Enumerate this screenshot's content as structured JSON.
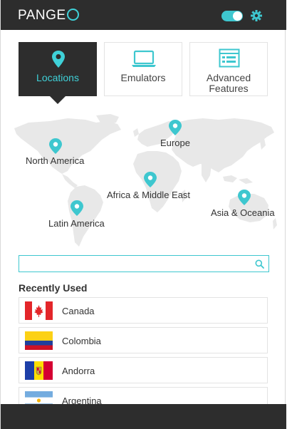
{
  "header": {
    "logo_prefix": "PANGE",
    "toggle_on": true
  },
  "tabs": [
    {
      "label": "Locations",
      "icon": "location-pin-icon",
      "active": true
    },
    {
      "label": "Emulators",
      "icon": "laptop-icon",
      "active": false
    },
    {
      "label_line1": "Advanced",
      "label_line2": "Features",
      "icon": "browser-window-icon",
      "active": false
    }
  ],
  "regions": [
    {
      "label": "North America"
    },
    {
      "label": "Europe"
    },
    {
      "label": "Africa & Middle East"
    },
    {
      "label": "Latin America"
    },
    {
      "label": "Asia & Oceania"
    }
  ],
  "search": {
    "value": "",
    "placeholder": ""
  },
  "recent": {
    "title": "Recently Used",
    "countries": [
      {
        "name": "Canada",
        "flag": "canada-flag"
      },
      {
        "name": "Colombia",
        "flag": "colombia-flag"
      },
      {
        "name": "Andorra",
        "flag": "andorra-flag"
      },
      {
        "name": "Argentina",
        "flag": "argentina-flag"
      }
    ]
  },
  "colors": {
    "accent": "#3ec7cf",
    "dark": "#2d2d2d",
    "map_land": "#e8e8e8"
  }
}
